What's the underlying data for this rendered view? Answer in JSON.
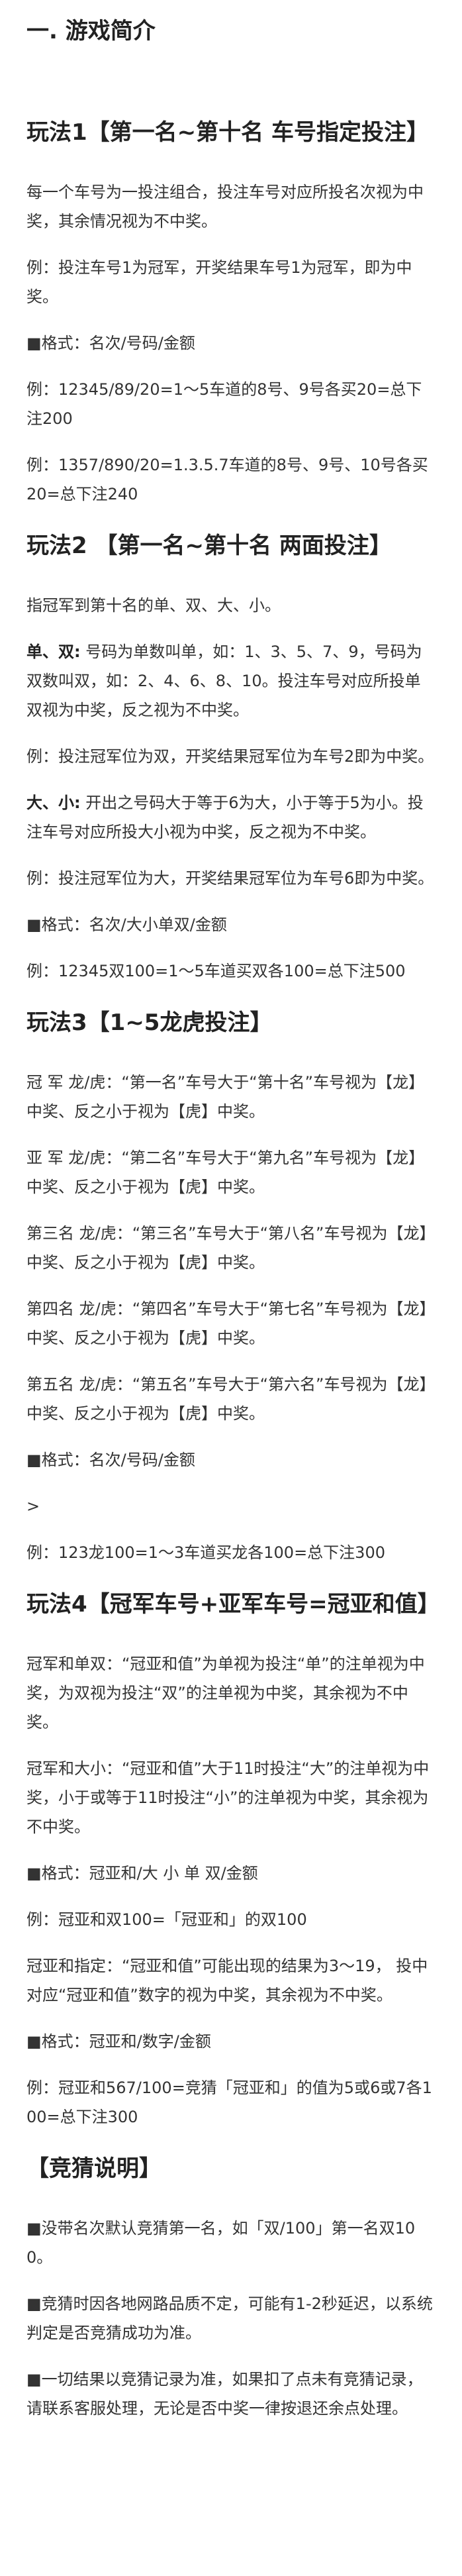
{
  "title": "一. 游戏简介",
  "sections": [
    {
      "title": "玩法1【第一名~第十名 车号指定投注】",
      "paragraphs": [
        {
          "text": "每一个车号为一投注组合，投注车号对应所投名次视为中奖，其余情况视为不中奖。"
        },
        {
          "text": "例：投注车号1为冠军，开奖结果车号1为冠军，即为中奖。"
        },
        {
          "text": "■格式：名次/号码/金额"
        },
        {
          "text": "例：12345/89/20=1～5车道的8号、9号各买20=总下注200"
        },
        {
          "text": "例：1357/890/20=1.3.5.7车道的8号、9号、10号各买20=总下注240"
        }
      ]
    },
    {
      "title": "玩法2 【第一名~第十名 两面投注】",
      "paragraphs": [
        {
          "text": "指冠军到第十名的单、双、大、小。"
        },
        {
          "term": "单、双:",
          "text": " 号码为单数叫单，如：1、3、5、7、9，号码为双数叫双，如：2、4、6、8、10。投注车号对应所投单双视为中奖，反之视为不中奖。"
        },
        {
          "text": "例：投注冠军位为双，开奖结果冠军位为车号2即为中奖。"
        },
        {
          "term": "大、小:",
          "text": " 开出之号码大于等于6为大，小于等于5为小。投注车号对应所投大小视为中奖，反之视为不中奖。"
        },
        {
          "text": "例：投注冠军位为大，开奖结果冠军位为车号6即为中奖。"
        },
        {
          "text": "■格式：名次/大小单双/金额"
        },
        {
          "text": "例：12345双100=1～5车道买双各100=总下注500"
        }
      ]
    },
    {
      "title": "玩法3【1~5龙虎投注】",
      "paragraphs": [
        {
          "text": "冠 军 龙/虎：“第一名”车号大于“第十名”车号视为【龙】中奖、反之小于视为【虎】中奖。"
        },
        {
          "text": "亚 军 龙/虎：“第二名”车号大于“第九名”车号视为【龙】中奖、反之小于视为【虎】中奖。"
        },
        {
          "text": "第三名 龙/虎：“第三名”车号大于“第八名”车号视为【龙】中奖、反之小于视为【虎】中奖。"
        },
        {
          "text": "第四名 龙/虎：“第四名”车号大于“第七名”车号视为【龙】中奖、反之小于视为【虎】中奖。"
        },
        {
          "text": "第五名 龙/虎：“第五名”车号大于“第六名”车号视为【龙】中奖、反之小于视为【虎】中奖。"
        },
        {
          "text": "■格式：名次/号码/金额"
        },
        {
          "text": ">"
        },
        {
          "text": "例：123龙100=1～3车道买龙各100=总下注300"
        }
      ]
    },
    {
      "title": "玩法4【冠军车号+亚军车号=冠亚和值】",
      "paragraphs": [
        {
          "text": "冠军和单双：“冠亚和值”为单视为投注“单”的注单视为中奖，为双视为投注“双”的注单视为中奖，其余视为不中奖。"
        },
        {
          "text": "冠军和大小：“冠亚和值”大于11时投注“大”的注单视为中奖，小于或等于11时投注“小”的注单视为中奖，其余视为不中奖。"
        },
        {
          "text": "■格式：冠亚和/大 小 单 双/金额"
        },
        {
          "text": "例：冠亚和双100=「冠亚和」的双100"
        },
        {
          "text": "冠亚和指定：“冠亚和值”可能出现的结果为3～19， 投中对应“冠亚和值”数字的视为中奖，其余视为不中奖。"
        },
        {
          "text": "■格式：冠亚和/数字/金额"
        },
        {
          "text": "例：冠亚和567/100=竞猜「冠亚和」的值为5或6或7各100=总下注300"
        }
      ]
    },
    {
      "title": "【竞猜说明】",
      "paragraphs": [
        {
          "text": "■没带名次默认竞猜第一名，如「双/100」第一名双100。"
        },
        {
          "text": "■竞猜时因各地网路品质不定，可能有1-2秒延迟，以系统判定是否竞猜成功为准。"
        },
        {
          "text": "■一切结果以竞猜记录为准，如果扣了点未有竞猜记录，请联系客服处理，无论是否中奖一律按退还余点处理。"
        }
      ]
    }
  ]
}
